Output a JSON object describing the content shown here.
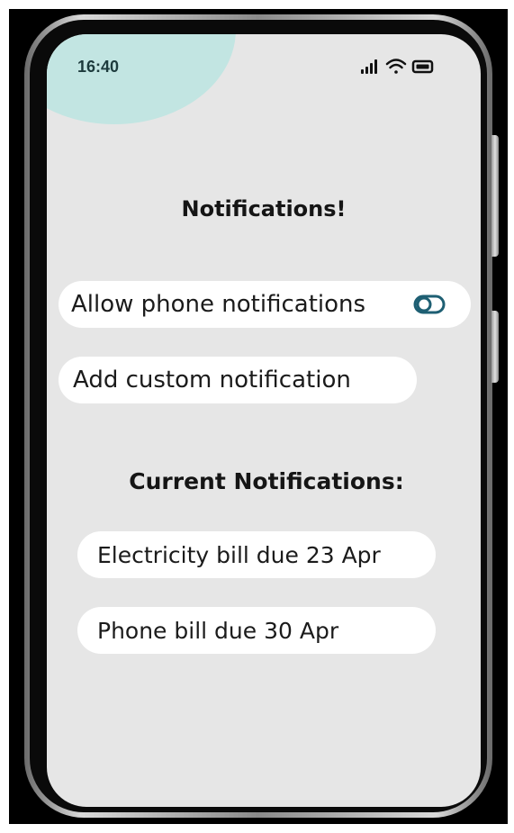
{
  "status_bar": {
    "time": "16:40",
    "icons": [
      "signal-icon",
      "wifi-icon",
      "battery-icon"
    ]
  },
  "colors": {
    "screen_background": "#e6e6e6",
    "accent_teal": "#c2e5e2",
    "toggle_color": "#1e5f73",
    "pill_background": "#ffffff"
  },
  "page": {
    "title": "Notifications!"
  },
  "settings": {
    "allow_phone_notifications": {
      "label": "Allow phone notifications",
      "icon": "toggle-icon"
    },
    "add_custom_notification": {
      "label": "Add custom notification"
    }
  },
  "current_notifications": {
    "heading": "Current Notifications:",
    "items": [
      {
        "label": "Electricity bill due 23 Apr"
      },
      {
        "label": "Phone bill due 30 Apr"
      }
    ]
  }
}
